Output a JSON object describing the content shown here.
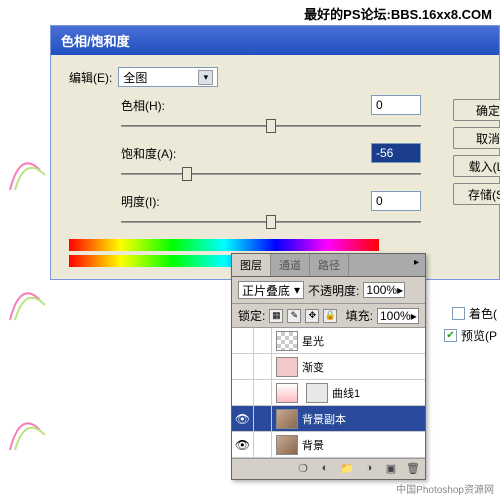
{
  "watermark_top": "最好的PS论坛:BBS.16xx8.COM",
  "watermark_bottom": "中国Photoshop资源网",
  "dialog": {
    "title": "色相/饱和度",
    "edit_label": "编辑(E):",
    "edit_value": "全图",
    "hue_label": "色相(H):",
    "hue_value": "0",
    "sat_label": "饱和度(A):",
    "sat_value": "-56",
    "light_label": "明度(I):",
    "light_value": "0",
    "buttons": {
      "ok": "确定",
      "cancel": "取消",
      "load": "载入(L)",
      "save": "存储(S)"
    },
    "colorize_label": "着色(",
    "preview_label": "预览(P"
  },
  "layers": {
    "tabs": {
      "layers": "图层",
      "channels": "通道",
      "paths": "路径"
    },
    "blend_mode": "正片叠底",
    "opacity_label": "不透明度:",
    "opacity_value": "100%",
    "lock_label": "锁定:",
    "fill_label": "填充:",
    "fill_value": "100%",
    "items": [
      {
        "name": "星光"
      },
      {
        "name": "渐变"
      },
      {
        "name": "曲线1"
      },
      {
        "name": "背景副本"
      },
      {
        "name": "背景"
      }
    ]
  }
}
